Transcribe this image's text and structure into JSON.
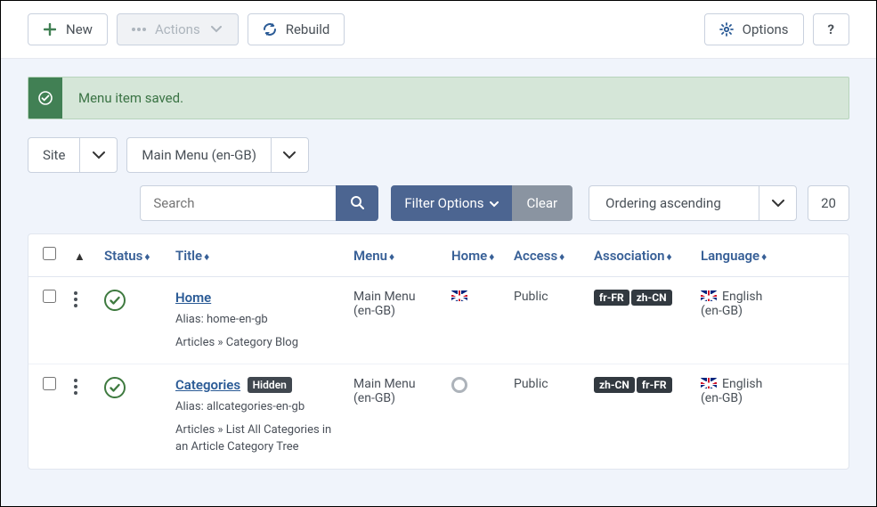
{
  "toolbar": {
    "new_label": "New",
    "actions_label": "Actions",
    "rebuild_label": "Rebuild",
    "options_label": "Options",
    "help_label": "?"
  },
  "alert": {
    "message": "Menu item saved."
  },
  "filters": {
    "client": "Site",
    "menu": "Main Menu (en-GB)",
    "search_placeholder": "Search",
    "filter_options_label": "Filter Options",
    "clear_label": "Clear",
    "ordering": "Ordering ascending",
    "limit": "20"
  },
  "columns": {
    "status": "Status",
    "title": "Title",
    "menu": "Menu",
    "home": "Home",
    "access": "Access",
    "association": "Association",
    "language": "Language"
  },
  "rows": [
    {
      "title": "Home",
      "alias": "Alias: home-en-gb",
      "type": "Articles » Category Blog",
      "hidden": false,
      "menu": "Main Menu (en-GB)",
      "home": "flag",
      "access": "Public",
      "assoc": [
        "fr-FR",
        "zh-CN"
      ],
      "language": "English (en-GB)"
    },
    {
      "title": "Categories",
      "alias": "Alias: allcategories-en-gb",
      "type": "Articles » List All Categories in an Article Category Tree",
      "hidden": true,
      "hidden_label": "Hidden",
      "menu": "Main Menu (en-GB)",
      "home": "circle",
      "access": "Public",
      "assoc": [
        "zh-CN",
        "fr-FR"
      ],
      "language": "English (en-GB)"
    }
  ]
}
